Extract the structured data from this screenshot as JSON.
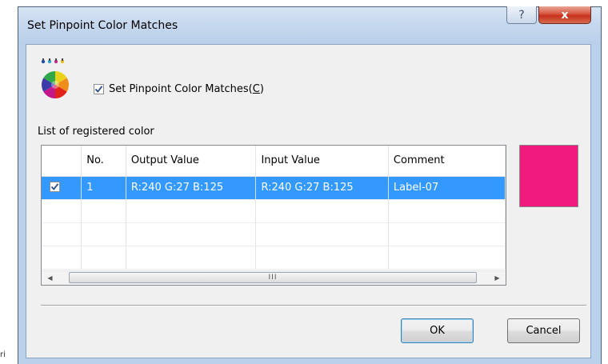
{
  "stray_text": "ri",
  "window": {
    "title": "Set Pinpoint Color Matches",
    "help_glyph": "?",
    "close_glyph": "x"
  },
  "enable_checkbox": {
    "label": "Set Pinpoint Color Matches(C)",
    "checked": true
  },
  "list": {
    "caption": "List of registered color",
    "columns": [
      "",
      "No.",
      "Output Value",
      "Input Value",
      "Comment"
    ],
    "rows": [
      {
        "checked": true,
        "no": "1",
        "output": "R:240 G:27 B:125",
        "input": "R:240 G:27 B:125",
        "comment": "Label-07",
        "selected": true
      }
    ],
    "scroll_thumb_glyph": "III"
  },
  "preview_color": "#f01b7d",
  "buttons": {
    "ok": "OK",
    "cancel": "Cancel"
  }
}
